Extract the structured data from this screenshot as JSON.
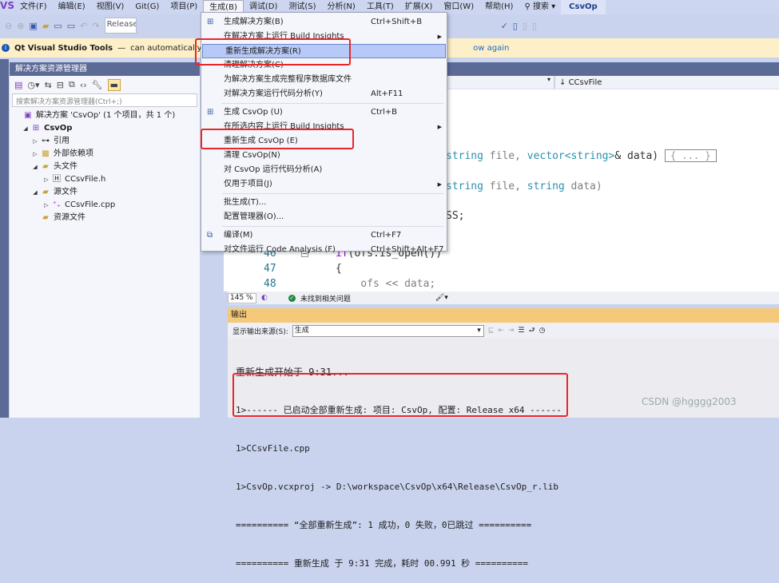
{
  "menubar": {
    "logo": "VS",
    "items": [
      "文件(F)",
      "编辑(E)",
      "视图(V)",
      "Git(G)",
      "项目(P)",
      "生成(B)",
      "调试(D)",
      "测试(S)",
      "分析(N)",
      "工具(T)",
      "扩展(X)",
      "窗口(W)",
      "帮助(H)"
    ],
    "search": "搜索",
    "window_title": "CsvOp"
  },
  "toolbar": {
    "config": "Release"
  },
  "infobar": {
    "title": "Qt Visual Studio Tools",
    "dash": "—",
    "message": "can automatically sea",
    "link": "ow again"
  },
  "solution_explorer": {
    "title": "解决方案资源管理器",
    "search_placeholder": "搜索解决方案资源管理器(Ctrl+;)",
    "tree": [
      {
        "label": "解决方案 'CsvOp' (1 个项目，共 1 个)",
        "icon": "solution-icon"
      },
      {
        "label": "CsvOp",
        "icon": "project-icon"
      },
      {
        "label": "引用",
        "icon": "reference-icon"
      },
      {
        "label": "外部依赖项",
        "icon": "dependency-icon"
      },
      {
        "label": "头文件",
        "icon": "folder-icon"
      },
      {
        "label": "CCsvFile.h",
        "icon": "header-file-icon"
      },
      {
        "label": "源文件",
        "icon": "folder-icon"
      },
      {
        "label": "CCsvFile.cpp",
        "icon": "cpp-file-icon"
      },
      {
        "label": "资源文件",
        "icon": "folder-icon"
      }
    ]
  },
  "build_menu": {
    "items": [
      {
        "label": "生成解决方案(B)",
        "shortcut": "Ctrl+Shift+B",
        "icon": "build-icon"
      },
      {
        "label": "在解决方案上运行 Build Insights",
        "submenu": true
      },
      {
        "label": "重新生成解决方案(R)",
        "highlighted": true
      },
      {
        "label": "清理解决方案(C)"
      },
      {
        "label": "为解决方案生成完整程序数据库文件"
      },
      {
        "label": "对解决方案运行代码分析(Y)",
        "shortcut": "Alt+F11"
      },
      {
        "label": "生成 CsvOp (U)",
        "shortcut": "Ctrl+B",
        "icon": "build-icon"
      },
      {
        "label": "在所选内容上运行 Build Insights",
        "submenu": true
      },
      {
        "label": "重新生成 CsvOp (E)"
      },
      {
        "label": "清理 CsvOp(N)"
      },
      {
        "label": "对 CsvOp 运行代码分析(A)"
      },
      {
        "label": "仅用于项目(J)",
        "submenu": true
      },
      {
        "label": "批生成(T)..."
      },
      {
        "label": "配置管理器(O)..."
      },
      {
        "label": "编译(M)",
        "shortcut": "Ctrl+F7",
        "icon": "compile-icon"
      },
      {
        "label": "对文件运行 Code Analysis (F)",
        "shortcut": "Ctrl+Shift+Alt+F7"
      }
    ]
  },
  "editor": {
    "nav_member": "CCsvFile",
    "line1": {
      "a": "string",
      "b": " file, ",
      "c": "vector<string>",
      "d": "& data)",
      "fold": "{ ... }"
    },
    "line2": {
      "a": "string",
      "b": " file, ",
      "c": "string",
      "d": " data)"
    },
    "line3": "SS;",
    "numbered": [
      {
        "n": "46",
        "kw": "if",
        "rest": "(ofs.is_open())"
      },
      {
        "n": "47",
        "rest": "{"
      },
      {
        "n": "48",
        "rest": "    ofs << data;"
      }
    ]
  },
  "statusbar": {
    "zoom": "145 %",
    "issues": "未找到相关问题"
  },
  "output": {
    "title": "输出",
    "source_label": "显示输出来源(S):",
    "source_value": "生成",
    "lines": [
      "重新生成开始于 9:31...",
      "1>------ 已启动全部重新生成: 项目: CsvOp, 配置: Release x64 ------",
      "1>CCsvFile.cpp",
      "1>CsvOp.vcxproj -> D:\\workspace\\CsvOp\\x64\\Release\\CsvOp_r.lib",
      "========== “全部重新生成”: 1 成功，0 失败，0已跳过 ==========",
      "========== 重新生成 于 9:31 完成，耗时 00.991 秒 =========="
    ]
  },
  "watermark": "CSDN @hgggg2003",
  "colors": {
    "highlight": "#e8262a",
    "titlebar": "#5c6a96",
    "output_title": "#f5c97a",
    "menu_hover": "#b7c9f7"
  }
}
